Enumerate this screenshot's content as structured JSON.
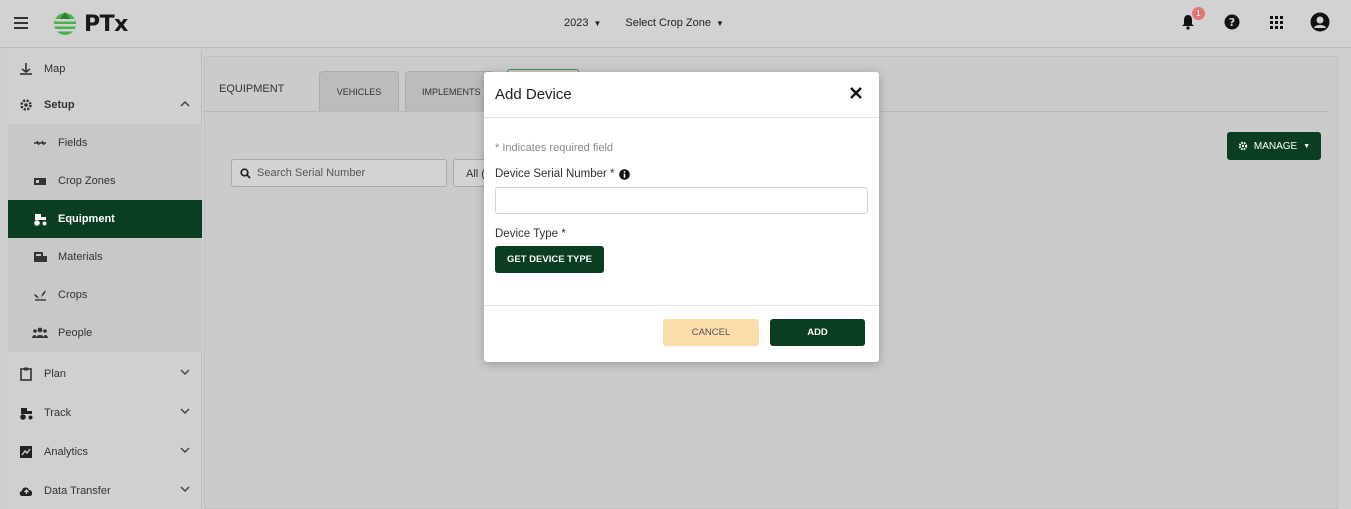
{
  "header": {
    "logo_text": "PTx",
    "year": "2023",
    "crop_zone": "Select Crop Zone",
    "notification_count": "1",
    "icons": [
      "menu-icon",
      "bell-icon",
      "help-icon",
      "apps-grid-icon",
      "account-icon"
    ]
  },
  "sidebar": {
    "items": [
      {
        "label": "Map",
        "icon": "map-icon"
      },
      {
        "label": "Setup",
        "icon": "gear-icon"
      },
      {
        "label": "Fields",
        "icon": "field-icon"
      },
      {
        "label": "Crop Zones",
        "icon": "crop-zone-icon"
      },
      {
        "label": "Equipment",
        "icon": "tractor-icon"
      },
      {
        "label": "Materials",
        "icon": "materials-icon"
      },
      {
        "label": "Crops",
        "icon": "crops-icon"
      },
      {
        "label": "People",
        "icon": "people-icon"
      },
      {
        "label": "Plan",
        "icon": "clipboard-icon"
      },
      {
        "label": "Track",
        "icon": "tractor-icon"
      },
      {
        "label": "Analytics",
        "icon": "chart-icon"
      },
      {
        "label": "Data Transfer",
        "icon": "cloud-icon"
      }
    ],
    "active": "Equipment"
  },
  "main": {
    "page_title": "EQUIPMENT",
    "tabs": [
      {
        "label": "VEHICLES"
      },
      {
        "label": "IMPLEMENTS"
      }
    ],
    "search": {
      "placeholder": "Search Serial Number"
    },
    "filter_value": "All (",
    "manage_label": "MANAGE"
  },
  "modal": {
    "title": "Add Device",
    "required_note": "* Indicates required field",
    "serial_label": "Device Serial Number *",
    "serial_value": "",
    "type_label": "Device Type *",
    "get_type_label": "GET DEVICE TYPE",
    "cancel_label": "CANCEL",
    "add_label": "ADD"
  },
  "colors": {
    "brand_green": "#0b3d22",
    "cancel_bg": "#fbdcaa",
    "badge_red": "#e57373"
  }
}
